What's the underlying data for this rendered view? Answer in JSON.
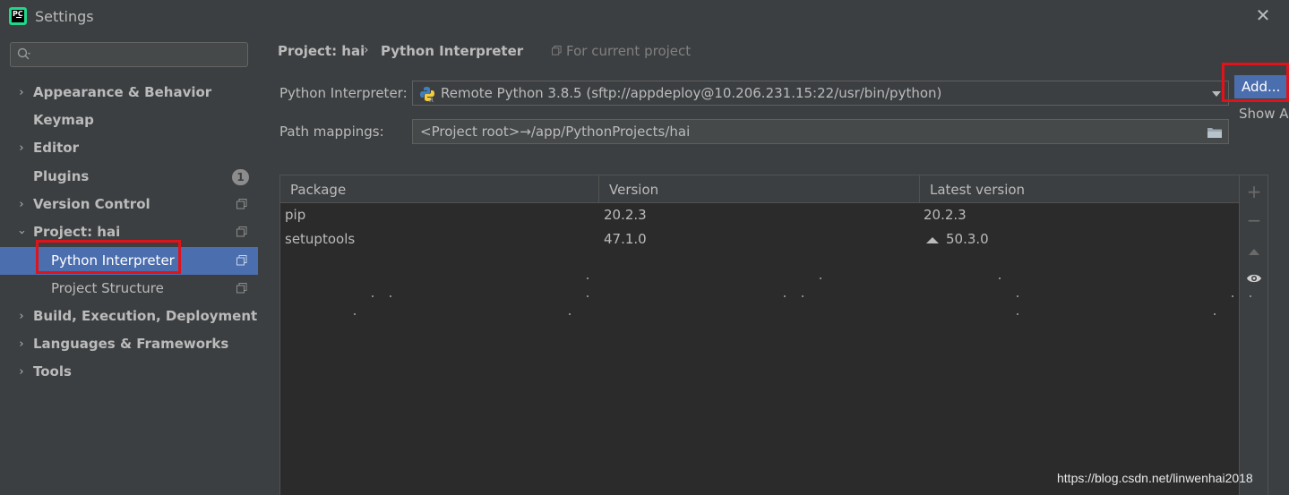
{
  "window": {
    "title": "Settings"
  },
  "sidebar": {
    "search_placeholder": "",
    "items": [
      {
        "label": "Appearance & Behavior",
        "expandable": true,
        "expanded": false
      },
      {
        "label": "Keymap"
      },
      {
        "label": "Editor",
        "expandable": true,
        "expanded": false
      },
      {
        "label": "Plugins",
        "badge": "1"
      },
      {
        "label": "Version Control",
        "expandable": true,
        "expanded": false
      },
      {
        "label": "Project: hai",
        "expandable": true,
        "expanded": true
      },
      {
        "label": "Python Interpreter",
        "selected": true
      },
      {
        "label": "Project Structure"
      },
      {
        "label": "Build, Execution, Deployment",
        "expandable": true,
        "expanded": false
      },
      {
        "label": "Languages & Frameworks",
        "expandable": true,
        "expanded": false
      },
      {
        "label": "Tools",
        "expandable": true,
        "expanded": false
      }
    ]
  },
  "breadcrumb": {
    "project": "Project: hai",
    "separator": "›",
    "page": "Python Interpreter",
    "scope": "For current project"
  },
  "interpreter": {
    "label": "Python Interpreter:",
    "value": "Remote Python 3.8.5 (sftp://appdeploy@10.206.231.15:22/usr/bin/python)"
  },
  "path_mappings": {
    "label": "Path mappings:",
    "value": "<Project root>→/app/PythonProjects/hai"
  },
  "popup_menu": {
    "add": "Add...",
    "show_all": "Show All..."
  },
  "packages": {
    "columns": [
      "Package",
      "Version",
      "Latest version"
    ],
    "rows": [
      {
        "package": "pip",
        "version": "20.2.3",
        "latest": "20.2.3",
        "upgrade_available": false
      },
      {
        "package": "setuptools",
        "version": "47.1.0",
        "latest": "50.3.0",
        "upgrade_available": true
      }
    ]
  },
  "toolbar": {
    "add": "+",
    "remove": "−"
  },
  "watermark": "https://blog.csdn.net/linwenhai2018",
  "colors": {
    "background": "#3c3f41",
    "table_background": "#2b2b2b",
    "selection": "#4b6eaf",
    "highlight_box": "#e0121a",
    "text": "#bbbbbb"
  }
}
